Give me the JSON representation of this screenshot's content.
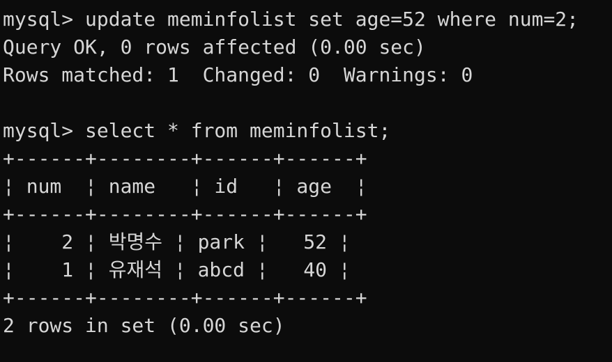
{
  "terminal": {
    "lines": [
      "mysql> update meminfolist set age=52 where num=2;",
      "Query OK, 0 rows affected (0.00 sec)",
      "Rows matched: 1  Changed: 0  Warnings: 0",
      "",
      "mysql> select * from meminfolist;",
      "+------+--------+------+------+",
      "¦ num  ¦ name   ¦ id   ¦ age  ¦",
      "+------+--------+------+------+",
      "¦    2 ¦ 박명수 ¦ park ¦   52 ¦",
      "¦    1 ¦ 유재석 ¦ abcd ¦   40 ¦",
      "+------+--------+------+------+",
      "2 rows in set (0.00 sec)"
    ]
  }
}
